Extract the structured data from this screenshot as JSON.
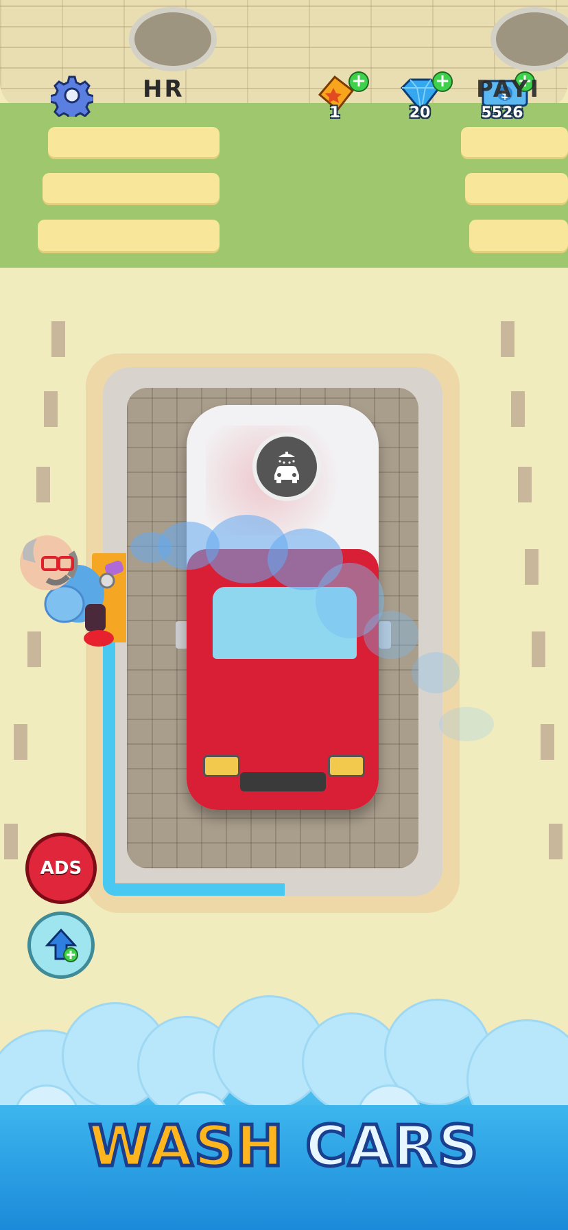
{
  "hud": {
    "player_tag": "HR",
    "tickets": "1",
    "gems": "20",
    "cash": "5526",
    "right_edge_text": "PAYI"
  },
  "buttons": {
    "no_ads_label": "ADS"
  },
  "banner": {
    "word1": "WASH",
    "word2": "CARS"
  },
  "icons": {
    "settings": "gear-icon",
    "ticket": "ticket-icon",
    "gem": "gem-icon",
    "cash": "cash-icon",
    "wash": "car-wash-icon",
    "boost": "boost-arrow-icon"
  },
  "progress": {
    "wash_progress_percent": 30
  },
  "colors": {
    "accent_blue": "#49c8f2",
    "car_red": "#d81f36",
    "plus_green": "#3fd14c",
    "title_orange": "#ffb61e",
    "title_outline": "#1b3f8f"
  }
}
